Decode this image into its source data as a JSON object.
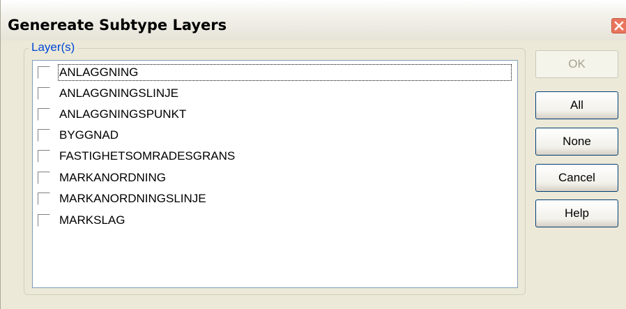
{
  "window": {
    "title": "Genereate Subtype Layers"
  },
  "group": {
    "label": "Layer(s)"
  },
  "layers": [
    {
      "label": "ANLAGGNING",
      "checked": false
    },
    {
      "label": "ANLAGGNINGSLINJE",
      "checked": false
    },
    {
      "label": "ANLAGGNINGSPUNKT",
      "checked": false
    },
    {
      "label": "BYGGNAD",
      "checked": false
    },
    {
      "label": "FASTIGHETSOMRADESGRANS",
      "checked": false
    },
    {
      "label": "MARKANORDNING",
      "checked": false
    },
    {
      "label": "MARKANORDNINGSLINJE",
      "checked": false
    },
    {
      "label": "MARKSLAG",
      "checked": false
    }
  ],
  "buttons": {
    "ok": "OK",
    "all": "All",
    "none": "None",
    "cancel": "Cancel",
    "help": "Help"
  },
  "colors": {
    "group_label": "#0046d5",
    "close_button": "#e8765e"
  }
}
